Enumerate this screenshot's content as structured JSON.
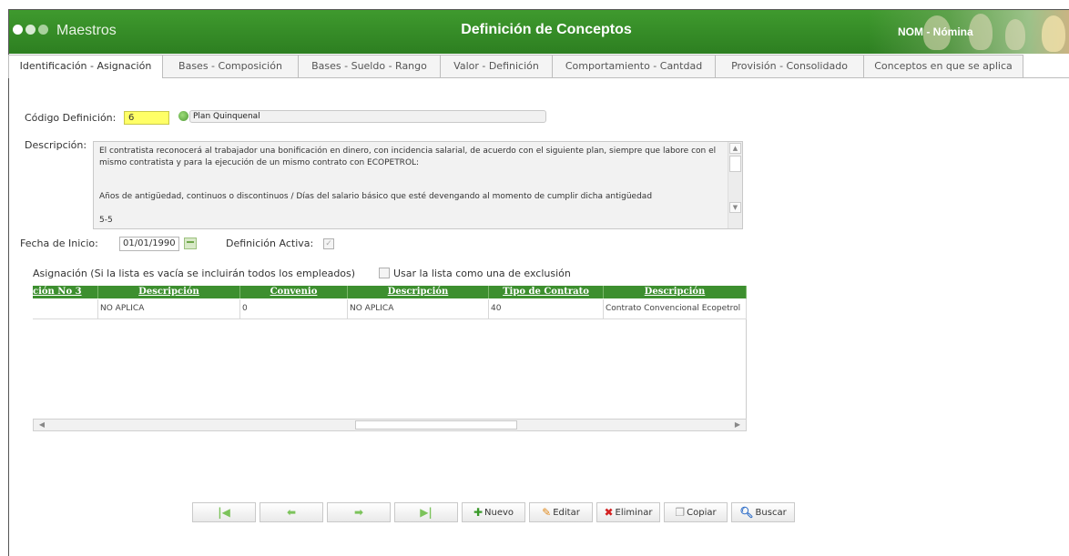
{
  "header": {
    "app_name": "Maestros",
    "page_title": "Definición de Conceptos",
    "module": "NOM - Nómina",
    "colors": {
      "header_green": "#3f9a2e",
      "grid_header_green": "#3d8f2f",
      "code_highlight": "#ffff66"
    }
  },
  "tabs": [
    {
      "label": "Identificación - Asignación",
      "active": true
    },
    {
      "label": "Bases - Composición"
    },
    {
      "label": "Bases - Sueldo - Rango"
    },
    {
      "label": "Valor - Definición"
    },
    {
      "label": "Comportamiento - Cantdad"
    },
    {
      "label": "Provisión - Consolidado"
    },
    {
      "label": "Conceptos en que se aplica"
    }
  ],
  "form": {
    "codigo_label": "Código Definición:",
    "codigo_value": "6",
    "nombre_value": "Plan Quinquenal",
    "descripcion_label": "Descripción:",
    "descripcion_lines": [
      "El contratista reconocerá al trabajador una bonificación en dinero, con incidencia salarial, de acuerdo con el siguiente plan, siempre que labore con el mismo contratista y para la ejecución de un mismo contrato con ECOPETROL:",
      "Años de antigüedad, continuos o discontinuos / Días del salario básico que esté devengando al momento de cumplir dicha antigüedad",
      "5-5"
    ],
    "fecha_label": "Fecha de Inicio:",
    "fecha_value": "01/01/1990",
    "activa_label": "Definición Activa:",
    "activa_checked": true,
    "asignacion_label": "Asignación (Si la lista es vacía se incluirán todos los empleados)",
    "exclusion_label": "Usar la lista como una de exclusión",
    "exclusion_checked": false
  },
  "grid": {
    "columns": [
      "ción No 3",
      "Descripción",
      "Convenio",
      "Descripción",
      "Tipo de Contrato",
      "Descripción"
    ],
    "rows": [
      [
        "",
        "NO APLICA",
        "0",
        "NO APLICA",
        "40",
        "Contrato Convencional Ecopetrol"
      ]
    ]
  },
  "toolbar": {
    "first_icon": "first-record-icon",
    "prev_icon": "previous-arrow-icon",
    "next_icon": "next-arrow-icon",
    "last_icon": "last-record-icon",
    "nuevo": "Nuevo",
    "editar": "Editar",
    "eliminar": "Eliminar",
    "copiar": "Copiar",
    "buscar": "Buscar"
  }
}
